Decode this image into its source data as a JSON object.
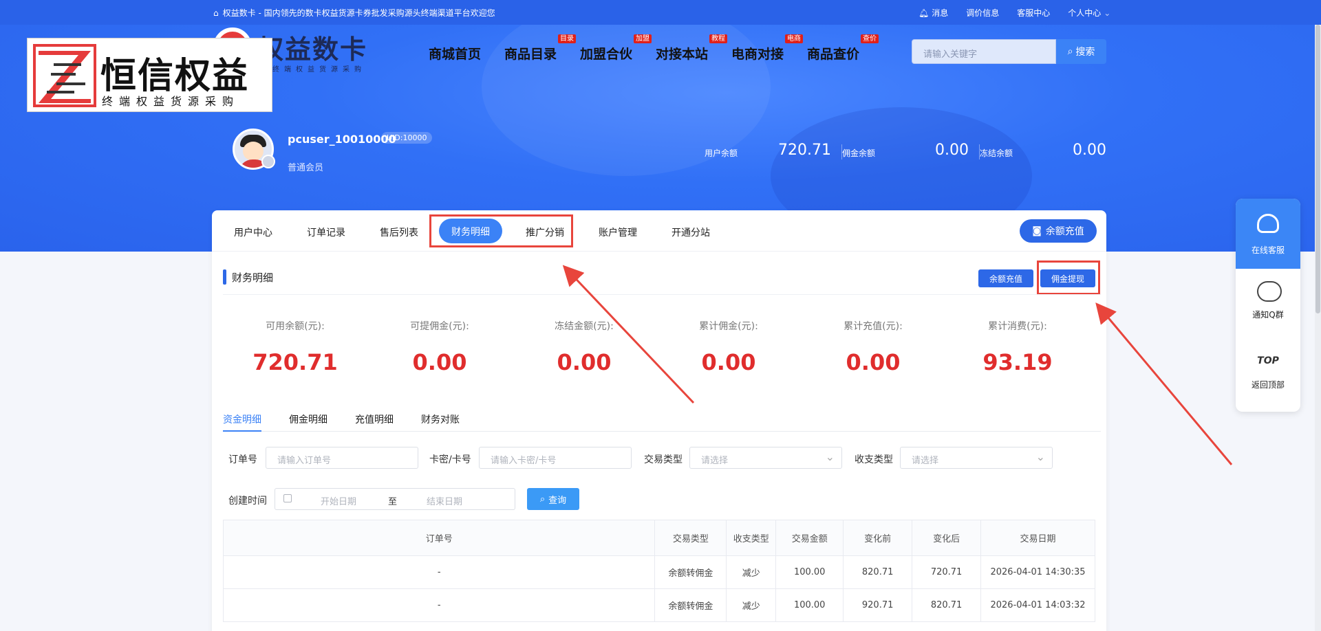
{
  "topbar": {
    "site_text": "权益数卡 - 国内领先的数卡权益货源卡券批发采购源头终端渠道平台欢迎您",
    "links": [
      "消息",
      "调价信息",
      "客服中心",
      "个人中心"
    ]
  },
  "brand": {
    "name": "权益数卡",
    "sub": "终端权益货源采购"
  },
  "watermark": {
    "title": "恒信权益",
    "sub": "终端权益货源采购"
  },
  "mainnav": {
    "items": [
      {
        "label": "商城首页",
        "tag": ""
      },
      {
        "label": "商品目录",
        "tag": "目录"
      },
      {
        "label": "加盟合伙",
        "tag": "加盟"
      },
      {
        "label": "对接本站",
        "tag": "教程"
      },
      {
        "label": "电商对接",
        "tag": "电商"
      },
      {
        "label": "商品查价",
        "tag": "查价"
      }
    ]
  },
  "search": {
    "placeholder": "请输入关键字",
    "button": "搜索"
  },
  "user": {
    "name": "pcuser_10010000",
    "uid": "UID:10000",
    "level": "普通会员",
    "balances": [
      {
        "label": "用户余额",
        "value": "720.71"
      },
      {
        "label": "佣金余额",
        "value": "0.00"
      },
      {
        "label": "冻结余额",
        "value": "0.00"
      }
    ]
  },
  "subnav": {
    "tabs": [
      "用户中心",
      "订单记录",
      "售后列表",
      "财务明细",
      "推广分销",
      "账户管理",
      "开通分站"
    ],
    "recharge": "余额充值"
  },
  "section": {
    "title": "财务明细",
    "btn_recharge": "余额充值",
    "btn_withdraw": "佣金提现"
  },
  "stats": [
    {
      "label": "可用余额(元):",
      "value": "720.71"
    },
    {
      "label": "可提佣金(元):",
      "value": "0.00"
    },
    {
      "label": "冻结金额(元):",
      "value": "0.00"
    },
    {
      "label": "累计佣金(元):",
      "value": "0.00"
    },
    {
      "label": "累计充值(元):",
      "value": "0.00"
    },
    {
      "label": "累计消费(元):",
      "value": "93.19"
    }
  ],
  "subtabs": [
    "资金明细",
    "佣金明细",
    "充值明细",
    "财务对账"
  ],
  "filters": {
    "order_label": "订单号",
    "order_ph": "请输入订单号",
    "card_label": "卡密/卡号",
    "card_ph": "请输入卡密/卡号",
    "trade_type_label": "交易类型",
    "trade_type_ph": "请选择",
    "io_type_label": "收支类型",
    "io_type_ph": "请选择",
    "date_label": "创建时间",
    "date_start": "开始日期",
    "date_to": "至",
    "date_end": "结束日期",
    "query": "查询"
  },
  "table": {
    "headers": [
      "订单号",
      "交易类型",
      "收支类型",
      "交易金额",
      "变化前",
      "变化后",
      "交易日期"
    ],
    "rows": [
      [
        "-",
        "余额转佣金",
        "减少",
        "100.00",
        "820.71",
        "720.71",
        "2026-04-01 14:30:35"
      ],
      [
        "-",
        "余额转佣金",
        "减少",
        "100.00",
        "920.71",
        "820.71",
        "2026-04-01 14:03:32"
      ]
    ]
  },
  "floating": {
    "service": "在线客服",
    "qq": "通知Q群",
    "top_glyph": "TOP",
    "back_top": "返回顶部"
  },
  "colors": {
    "primary": "#2d68e7",
    "accent_red": "#e02d2d",
    "highlight": "#e8453c"
  }
}
